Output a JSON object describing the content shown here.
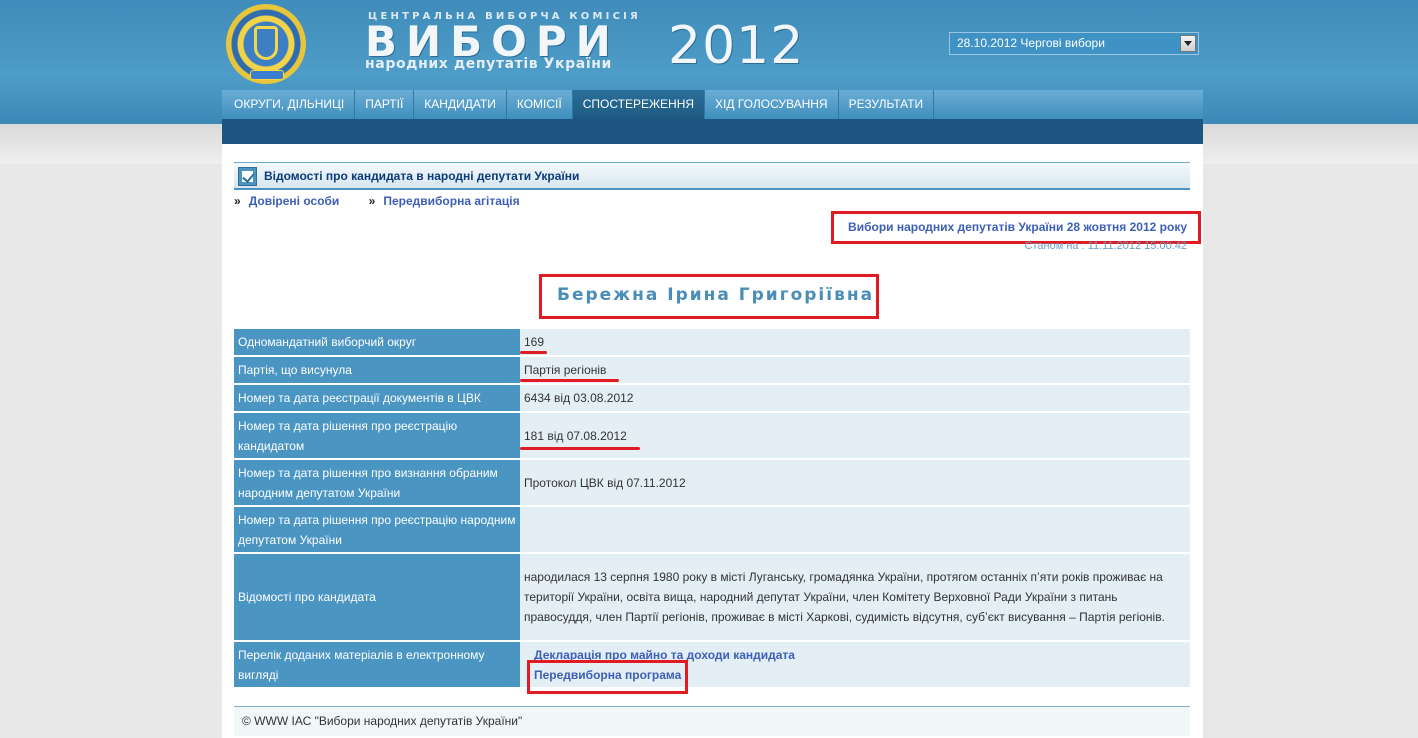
{
  "header": {
    "cvk_label": "ЦЕНТРАЛЬНА ВИБОРЧА КОМІСІЯ",
    "title": "ВИБОРИ",
    "year": "2012",
    "subtitle": "народних депутатів України",
    "election_select": "28.10.2012 Чергові вибори"
  },
  "nav": {
    "items": [
      {
        "label": "ОКРУГИ, ДІЛЬНИЦІ"
      },
      {
        "label": "ПАРТІЇ"
      },
      {
        "label": "КАНДИДАТИ"
      },
      {
        "label": "КОМІСІЇ"
      },
      {
        "label": "СПОСТЕРЕЖЕННЯ"
      },
      {
        "label": "ХІД ГОЛОСУВАННЯ"
      },
      {
        "label": "РЕЗУЛЬТАТИ"
      }
    ]
  },
  "page": {
    "section_title": "Відомості про кандидата в народні депутати України",
    "links": [
      "Довірені особи",
      "Передвиборна агітація"
    ],
    "link_arrow": "»",
    "election_title": "Вибори народних депутатів України 28 жовтня 2012 року",
    "as_of": "Станом на : 11.11.2012 15:00:42",
    "candidate_name": "Бережна Ірина Григоріївна"
  },
  "table": {
    "rows": [
      {
        "label": "Одномандатний виборчий округ",
        "value": "169"
      },
      {
        "label": "Партія, що висунула",
        "value": "Партія регіонів"
      },
      {
        "label": "Номер та дата реєстрації документів в ЦВК",
        "value": "6434 від 03.08.2012"
      },
      {
        "label": "Номер та дата рішення про реєстрацію кандидатом",
        "value": "181 від 07.08.2012"
      },
      {
        "label": "Номер та дата рішення про визнання обраним народним депутатом України",
        "value": "Протокол ЦВК від 07.11.2012"
      },
      {
        "label": "Номер та дата рішення про реєстрацію народним депутатом України",
        "value": ""
      },
      {
        "label": "Відомості про кандидата",
        "value": "народилася 13 серпня 1980 року в місті Луганську, громадянка України, протягом останніх п’яти років проживає на території України, освіта вища, народний депутат України, член Комітету Верховної Ради України з питань правосуддя, член Партії регіонів, проживає в місті Харкові, судимість відсутня, суб’єкт висування – Партія регіонів."
      },
      {
        "label": "Перелік доданих матеріалів в електронному вигляді",
        "links": [
          "Декларація про майно та доходи кандидата",
          "Передвиборна програма"
        ]
      }
    ]
  },
  "footer": {
    "text": "© WWW ІАС \"Вибори народних депутатів України\""
  },
  "colors": {
    "header_blue": "#4e9cc8",
    "label_cell": "#4b95c3",
    "value_cell": "#e3eef5",
    "link": "#3d5fb7",
    "annotation_red": "#e21b23"
  }
}
